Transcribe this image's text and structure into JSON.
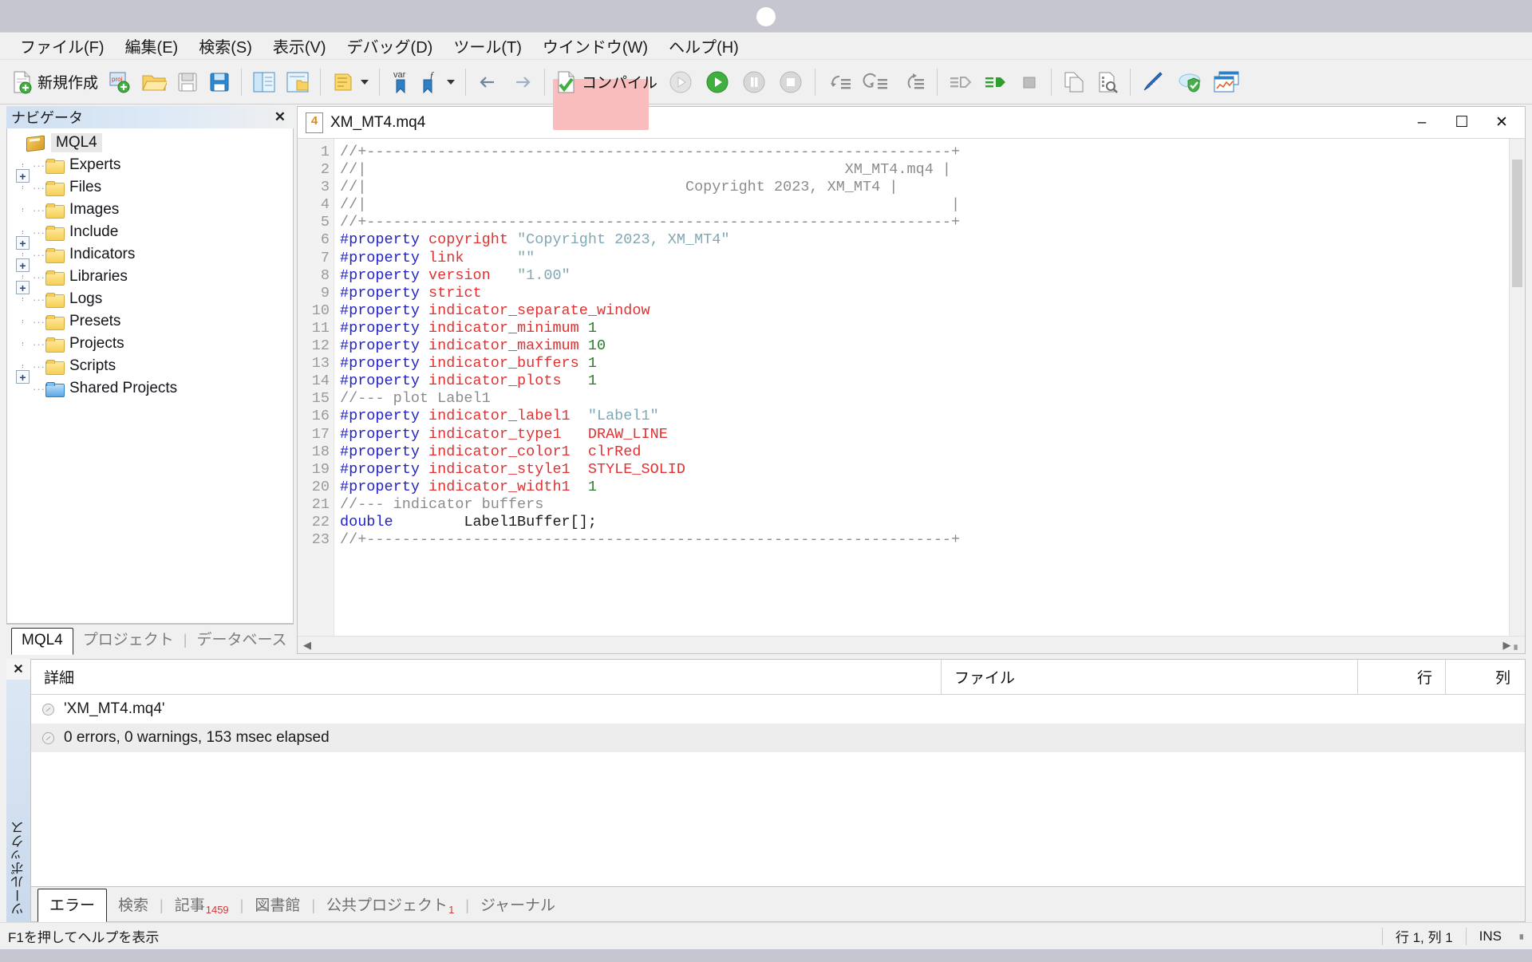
{
  "window": {
    "title_dot": "",
    "minimize_label": "–",
    "maximize_label": "☐",
    "close_label": "✕"
  },
  "menubar": [
    {
      "label": "ファイル(F)",
      "name": "menu-file"
    },
    {
      "label": "編集(E)",
      "name": "menu-edit"
    },
    {
      "label": "検索(S)",
      "name": "menu-search"
    },
    {
      "label": "表示(V)",
      "name": "menu-view"
    },
    {
      "label": "デバッグ(D)",
      "name": "menu-debug"
    },
    {
      "label": "ツール(T)",
      "name": "menu-tools"
    },
    {
      "label": "ウインドウ(W)",
      "name": "menu-window"
    },
    {
      "label": "ヘルプ(H)",
      "name": "menu-help"
    }
  ],
  "toolbar": {
    "new_label": "新規作成",
    "compile_label": "コンパイル",
    "highlight_color": "#f9bdbd",
    "icons": [
      "new-file-icon",
      "new-project-icon",
      "open-folder-icon",
      "save-icon",
      "save-all-icon",
      "navigator-toggle-icon",
      "toolbox-toggle-icon",
      "properties-icon",
      "dropdown-caret-icon",
      "insert-variable-icon",
      "insert-function-icon",
      "dropdown-caret-icon",
      "back-arrow-icon",
      "forward-arrow-icon",
      "compile-icon",
      "debug-history-icon",
      "debug-start-icon",
      "debug-pause-icon",
      "debug-stop-icon",
      "step-into-icon",
      "step-over-icon",
      "step-out-icon",
      "run-to-cursor-icon",
      "run-script-icon",
      "stop-square-icon",
      "copy-icon",
      "find-in-file-icon",
      "styler-icon",
      "cloud-protect-icon",
      "market-chart-icon"
    ]
  },
  "navigator": {
    "title": "ナビゲータ",
    "close_label": "✕",
    "root": {
      "label": "MQL4",
      "icon": "mql-package-icon",
      "selected": true
    },
    "items": [
      {
        "label": "Experts",
        "expandable": true,
        "icon": "folder-icon"
      },
      {
        "label": "Files",
        "expandable": false,
        "icon": "folder-icon"
      },
      {
        "label": "Images",
        "expandable": false,
        "icon": "folder-icon"
      },
      {
        "label": "Include",
        "expandable": true,
        "icon": "folder-icon"
      },
      {
        "label": "Indicators",
        "expandable": true,
        "icon": "folder-icon"
      },
      {
        "label": "Libraries",
        "expandable": true,
        "icon": "folder-icon"
      },
      {
        "label": "Logs",
        "expandable": false,
        "icon": "folder-icon"
      },
      {
        "label": "Presets",
        "expandable": false,
        "icon": "folder-icon"
      },
      {
        "label": "Projects",
        "expandable": false,
        "icon": "folder-icon"
      },
      {
        "label": "Scripts",
        "expandable": true,
        "icon": "folder-icon"
      },
      {
        "label": "Shared Projects",
        "expandable": false,
        "icon": "folder-icon-blue"
      }
    ],
    "tabs": [
      {
        "label": "MQL4",
        "active": true
      },
      {
        "label": "プロジェクト",
        "active": false
      },
      {
        "label": "データベース",
        "active": false
      }
    ]
  },
  "editor": {
    "tab_title": "XM_MT4.mq4",
    "doc_icon_badge": "4",
    "lines": [
      {
        "n": 1,
        "tokens": [
          {
            "t": "//+------------------------------------------------------------------+",
            "c": "com"
          }
        ]
      },
      {
        "n": 2,
        "tokens": [
          {
            "t": "//|                                                      XM_MT4.mq4 |",
            "c": "com"
          }
        ]
      },
      {
        "n": 3,
        "tokens": [
          {
            "t": "//|                                    Copyright 2023, XM_MT4 |",
            "c": "com"
          }
        ]
      },
      {
        "n": 4,
        "tokens": [
          {
            "t": "//|                                                                  |",
            "c": "com"
          }
        ]
      },
      {
        "n": 5,
        "tokens": [
          {
            "t": "//+------------------------------------------------------------------+",
            "c": "com"
          }
        ]
      },
      {
        "n": 6,
        "tokens": [
          {
            "t": "#property ",
            "c": "prop"
          },
          {
            "t": "copyright ",
            "c": "key"
          },
          {
            "t": "\"Copyright 2023, XM_MT4\"",
            "c": "str"
          }
        ]
      },
      {
        "n": 7,
        "tokens": [
          {
            "t": "#property ",
            "c": "prop"
          },
          {
            "t": "link      ",
            "c": "key"
          },
          {
            "t": "\"\"",
            "c": "str"
          }
        ]
      },
      {
        "n": 8,
        "tokens": [
          {
            "t": "#property ",
            "c": "prop"
          },
          {
            "t": "version   ",
            "c": "key"
          },
          {
            "t": "\"1.00\"",
            "c": "str"
          }
        ]
      },
      {
        "n": 9,
        "tokens": [
          {
            "t": "#property ",
            "c": "prop"
          },
          {
            "t": "strict",
            "c": "key"
          }
        ]
      },
      {
        "n": 10,
        "tokens": [
          {
            "t": "#property ",
            "c": "prop"
          },
          {
            "t": "indicator_separate_window",
            "c": "key"
          }
        ]
      },
      {
        "n": 11,
        "tokens": [
          {
            "t": "#property ",
            "c": "prop"
          },
          {
            "t": "indicator_minimum ",
            "c": "key"
          },
          {
            "t": "1",
            "c": "num"
          }
        ]
      },
      {
        "n": 12,
        "tokens": [
          {
            "t": "#property ",
            "c": "prop"
          },
          {
            "t": "indicator_maximum ",
            "c": "key"
          },
          {
            "t": "10",
            "c": "num"
          }
        ]
      },
      {
        "n": 13,
        "tokens": [
          {
            "t": "#property ",
            "c": "prop"
          },
          {
            "t": "indicator_buffers ",
            "c": "key"
          },
          {
            "t": "1",
            "c": "num"
          }
        ]
      },
      {
        "n": 14,
        "tokens": [
          {
            "t": "#property ",
            "c": "prop"
          },
          {
            "t": "indicator_plots   ",
            "c": "key"
          },
          {
            "t": "1",
            "c": "num"
          }
        ]
      },
      {
        "n": 15,
        "tokens": [
          {
            "t": "//--- plot Label1",
            "c": "com"
          }
        ]
      },
      {
        "n": 16,
        "tokens": [
          {
            "t": "#property ",
            "c": "prop"
          },
          {
            "t": "indicator_label1  ",
            "c": "key"
          },
          {
            "t": "\"Label1\"",
            "c": "str"
          }
        ]
      },
      {
        "n": 17,
        "tokens": [
          {
            "t": "#property ",
            "c": "prop"
          },
          {
            "t": "indicator_type1   ",
            "c": "key"
          },
          {
            "t": "DRAW_LINE",
            "c": "key"
          }
        ]
      },
      {
        "n": 18,
        "tokens": [
          {
            "t": "#property ",
            "c": "prop"
          },
          {
            "t": "indicator_color1  ",
            "c": "key"
          },
          {
            "t": "clrRed",
            "c": "key"
          }
        ]
      },
      {
        "n": 19,
        "tokens": [
          {
            "t": "#property ",
            "c": "prop"
          },
          {
            "t": "indicator_style1  ",
            "c": "key"
          },
          {
            "t": "STYLE_SOLID",
            "c": "key"
          }
        ]
      },
      {
        "n": 20,
        "tokens": [
          {
            "t": "#property ",
            "c": "prop"
          },
          {
            "t": "indicator_width1  ",
            "c": "key"
          },
          {
            "t": "1",
            "c": "num"
          }
        ]
      },
      {
        "n": 21,
        "tokens": [
          {
            "t": "//--- indicator buffers",
            "c": "com"
          }
        ]
      },
      {
        "n": 22,
        "tokens": [
          {
            "t": "double",
            "c": "type"
          },
          {
            "t": "        Label1Buffer[];",
            "c": "plain"
          }
        ]
      },
      {
        "n": 23,
        "tokens": [
          {
            "t": "//+------------------------------------------------------------------+",
            "c": "com"
          }
        ]
      }
    ]
  },
  "toolbox": {
    "vertical_label": "ツールボックス",
    "close_label": "✕",
    "columns": [
      {
        "label": "詳細"
      },
      {
        "label": "ファイル"
      },
      {
        "label": "行"
      },
      {
        "label": "列"
      }
    ],
    "rows": [
      {
        "detail": "'XM_MT4.mq4'",
        "file": "",
        "line": "",
        "col": ""
      },
      {
        "detail": "0 errors, 0 warnings, 153 msec elapsed",
        "file": "",
        "line": "",
        "col": ""
      }
    ],
    "tabs": [
      {
        "label": "エラー",
        "badge": "",
        "active": true
      },
      {
        "label": "検索",
        "badge": "",
        "active": false
      },
      {
        "label": "記事",
        "badge": "1459",
        "active": false
      },
      {
        "label": "図書館",
        "badge": "",
        "active": false
      },
      {
        "label": "公共プロジェクト",
        "badge": "1",
        "active": false
      },
      {
        "label": "ジャーナル",
        "badge": "",
        "active": false
      }
    ]
  },
  "statusbar": {
    "hint": "F1を押してヘルプを表示",
    "position": "行 1, 列 1",
    "insert_mode": "INS"
  }
}
